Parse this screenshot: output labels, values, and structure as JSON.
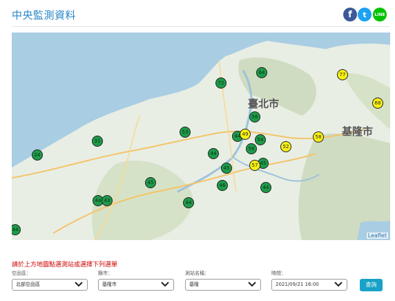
{
  "page": {
    "title": "中央監測資料"
  },
  "share": {
    "facebook_glyph": "f",
    "twitter_glyph": "t",
    "line_glyph": "LINE"
  },
  "map": {
    "city_labels": [
      "臺北市",
      "基隆市"
    ],
    "attribution": "Leaflet",
    "markers": [
      {
        "value": "64",
        "color": "green"
      },
      {
        "value": "77",
        "color": "yellow"
      },
      {
        "value": "72",
        "color": "green"
      },
      {
        "value": "68",
        "color": "yellow"
      },
      {
        "value": "56",
        "color": "green"
      },
      {
        "value": "53",
        "color": "green"
      },
      {
        "value": "58",
        "color": "yellow"
      },
      {
        "value": "31",
        "color": "green"
      },
      {
        "value": "44",
        "color": "green"
      },
      {
        "value": "49",
        "color": "yellow"
      },
      {
        "value": "54",
        "color": "green"
      },
      {
        "value": "52",
        "color": "yellow"
      },
      {
        "value": "24",
        "color": "green"
      },
      {
        "value": "56",
        "color": "green"
      },
      {
        "value": "44",
        "color": "green"
      },
      {
        "value": "45",
        "color": "green"
      },
      {
        "value": "57",
        "color": "yellow"
      },
      {
        "value": "45",
        "color": "green"
      },
      {
        "value": "46",
        "color": "green"
      },
      {
        "value": "45",
        "color": "green"
      },
      {
        "value": "44",
        "color": "green"
      },
      {
        "value": "44",
        "color": "green"
      },
      {
        "value": "43",
        "color": "green"
      },
      {
        "value": "44",
        "color": "green"
      },
      {
        "value": "44",
        "color": "green"
      }
    ]
  },
  "form": {
    "hint": "請於上方地圖點選測站或選擇下列選單",
    "air_zone_label": "空品區：",
    "air_zone_value": "北部空品區",
    "county_label": "縣市：",
    "county_value": "基隆市",
    "station_label": "測站名稱：",
    "station_value": "基隆",
    "time_label": "時間：",
    "time_value": "2021/09/21 16:00",
    "query_label": "查詢"
  },
  "colors": {
    "title": "#2a87c8",
    "marker_green": "#1e9b4a",
    "marker_yellow": "#f7ef14",
    "hint_red": "#cc0000",
    "query_button": "#17a2c8"
  }
}
